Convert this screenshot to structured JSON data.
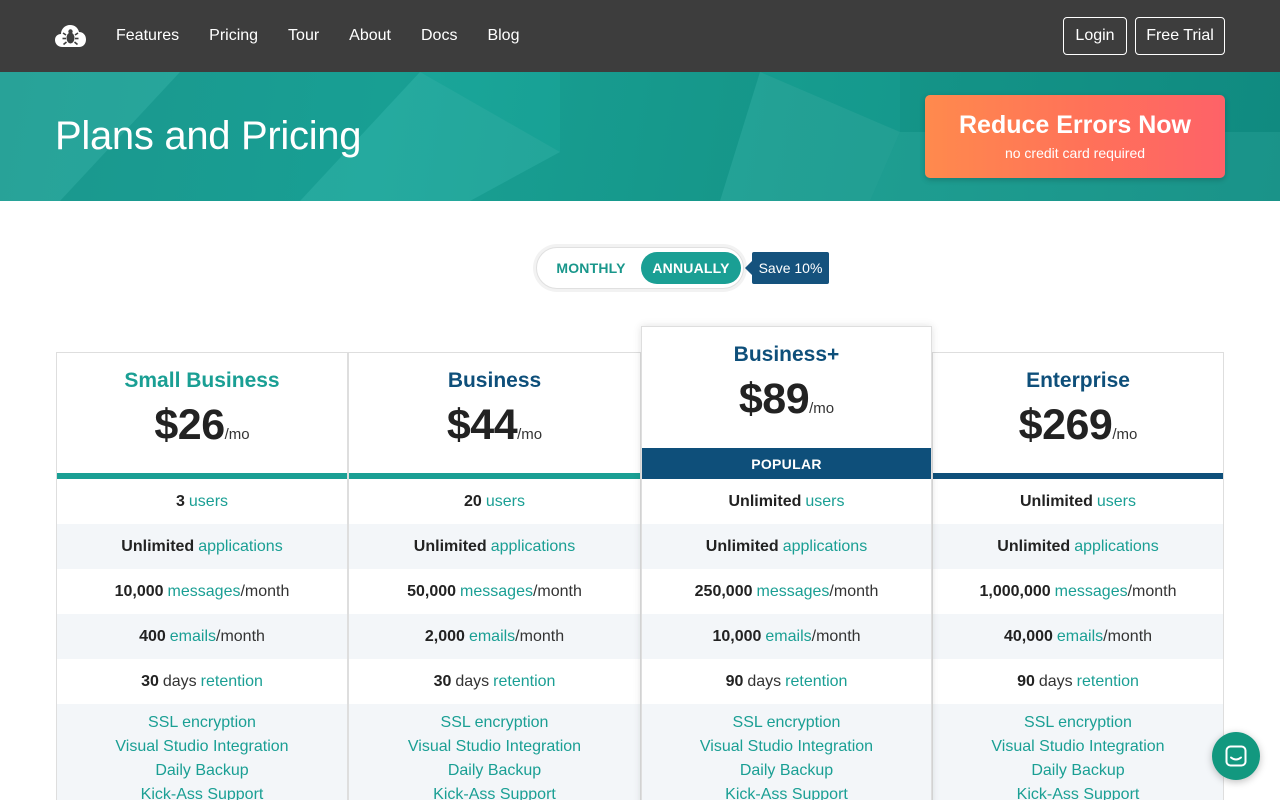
{
  "nav": {
    "links": [
      "Features",
      "Pricing",
      "Tour",
      "About",
      "Docs",
      "Blog"
    ],
    "login": "Login",
    "trial": "Free Trial"
  },
  "hero": {
    "title": "Plans and Pricing",
    "cta_main": "Reduce Errors Now",
    "cta_sub": "no credit card required"
  },
  "billing": {
    "monthly": "MONTHLY",
    "annually": "ANNUALLY",
    "selected": "ANNUALLY",
    "save": "Save 10%"
  },
  "popular_label": "POPULAR",
  "colors": {
    "teal": "#1a9f94",
    "navy": "#0e4f7a",
    "cta_start": "#ff8a4d",
    "cta_end": "#fe6268"
  },
  "plans": [
    {
      "name": "Small Business",
      "price": "$26",
      "per": "/mo",
      "popular": false,
      "users": {
        "value": "3",
        "label": "users"
      },
      "applications": {
        "value": "Unlimited",
        "label": "applications"
      },
      "messages": {
        "value": "10,000",
        "label": "messages",
        "suffix": "/month"
      },
      "emails": {
        "value": "400",
        "label": "emails",
        "suffix": "/month"
      },
      "retention": {
        "value": "30",
        "mid": "days",
        "label": "retention"
      },
      "features": [
        "SSL encryption",
        "Visual Studio Integration",
        "Daily Backup",
        "Kick-Ass Support"
      ]
    },
    {
      "name": "Business",
      "price": "$44",
      "per": "/mo",
      "popular": false,
      "users": {
        "value": "20",
        "label": "users"
      },
      "applications": {
        "value": "Unlimited",
        "label": "applications"
      },
      "messages": {
        "value": "50,000",
        "label": "messages",
        "suffix": "/month"
      },
      "emails": {
        "value": "2,000",
        "label": "emails",
        "suffix": "/month"
      },
      "retention": {
        "value": "30",
        "mid": "days",
        "label": "retention"
      },
      "features": [
        "SSL encryption",
        "Visual Studio Integration",
        "Daily Backup",
        "Kick-Ass Support"
      ]
    },
    {
      "name": "Business+",
      "price": "$89",
      "per": "/mo",
      "popular": true,
      "users": {
        "value": "Unlimited",
        "label": "users"
      },
      "applications": {
        "value": "Unlimited",
        "label": "applications"
      },
      "messages": {
        "value": "250,000",
        "label": "messages",
        "suffix": "/month"
      },
      "emails": {
        "value": "10,000",
        "label": "emails",
        "suffix": "/month"
      },
      "retention": {
        "value": "90",
        "mid": "days",
        "label": "retention"
      },
      "features": [
        "SSL encryption",
        "Visual Studio Integration",
        "Daily Backup",
        "Kick-Ass Support"
      ]
    },
    {
      "name": "Enterprise",
      "price": "$269",
      "per": "/mo",
      "popular": false,
      "users": {
        "value": "Unlimited",
        "label": "users"
      },
      "applications": {
        "value": "Unlimited",
        "label": "applications"
      },
      "messages": {
        "value": "1,000,000",
        "label": "messages",
        "suffix": "/month"
      },
      "emails": {
        "value": "40,000",
        "label": "emails",
        "suffix": "/month"
      },
      "retention": {
        "value": "90",
        "mid": "days",
        "label": "retention"
      },
      "features": [
        "SSL encryption",
        "Visual Studio Integration",
        "Daily Backup",
        "Kick-Ass Support"
      ]
    }
  ]
}
